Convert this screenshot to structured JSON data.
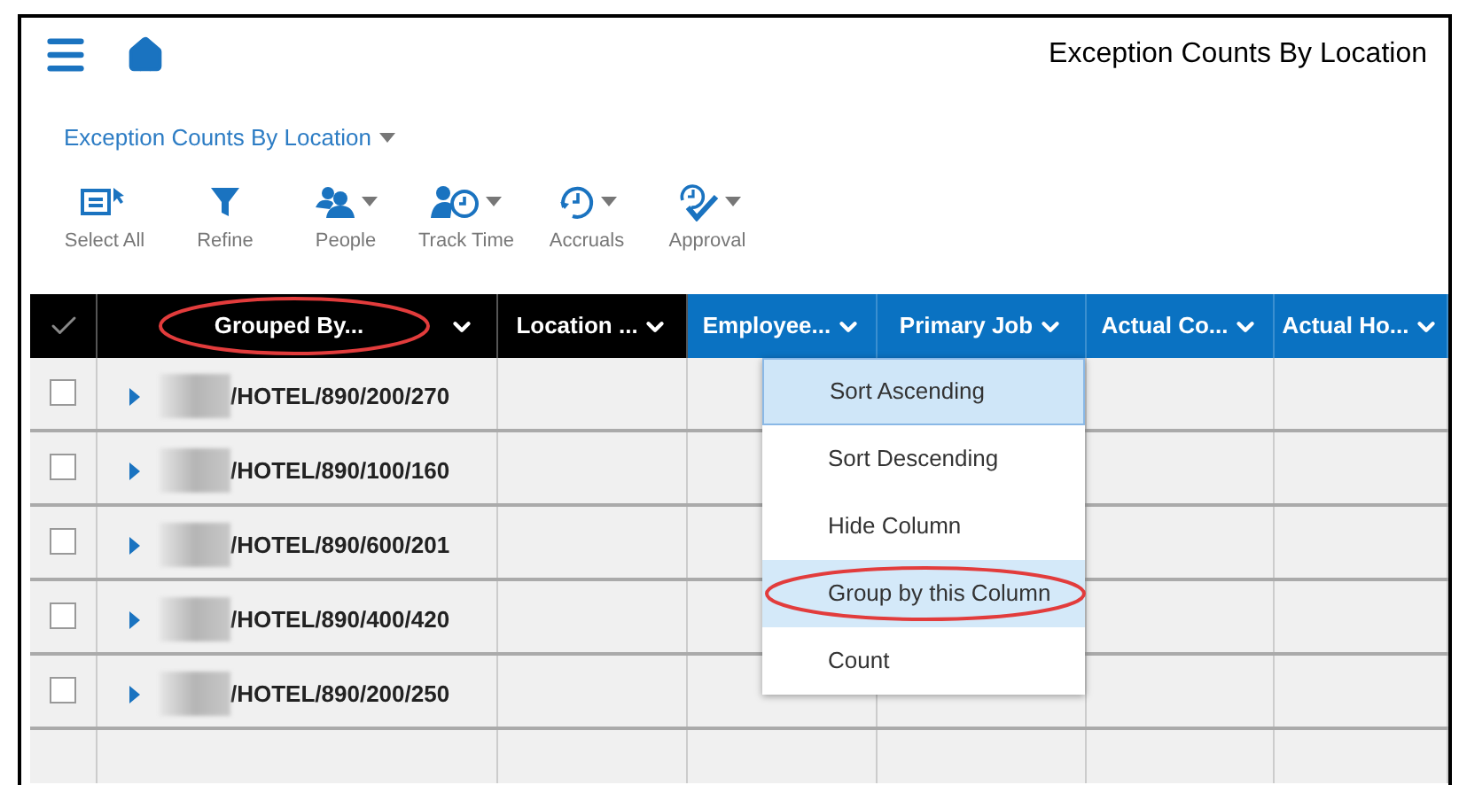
{
  "header": {
    "title": "Exception Counts By Location"
  },
  "view_selector": {
    "label": "Exception Counts By Location"
  },
  "toolbar": [
    {
      "label": "Select All",
      "kind": "select",
      "has_menu": false
    },
    {
      "label": "Refine",
      "kind": "filter",
      "has_menu": false
    },
    {
      "label": "People",
      "kind": "people",
      "has_menu": true
    },
    {
      "label": "Track Time",
      "kind": "time",
      "has_menu": true
    },
    {
      "label": "Accruals",
      "kind": "accruals",
      "has_menu": true
    },
    {
      "label": "Approval",
      "kind": "approval",
      "has_menu": true
    }
  ],
  "table": {
    "select_all_checked": true,
    "columns": [
      {
        "label": "Grouped By...",
        "kind": "group",
        "circled": true
      },
      {
        "label": "Location ...",
        "kind": "group",
        "circled": false
      },
      {
        "label": "Employee...",
        "kind": "data",
        "circled": false
      },
      {
        "label": "Primary Job",
        "kind": "data",
        "circled": false
      },
      {
        "label": "Actual Co...",
        "kind": "data",
        "circled": false
      },
      {
        "label": "Actual Ho...",
        "kind": "data",
        "circled": false
      }
    ],
    "rows": [
      {
        "group": "/HOTEL/890/200/270",
        "checked": false,
        "expanded": false
      },
      {
        "group": "/HOTEL/890/100/160",
        "checked": false,
        "expanded": false
      },
      {
        "group": "/HOTEL/890/600/201",
        "checked": false,
        "expanded": false
      },
      {
        "group": "/HOTEL/890/400/420",
        "checked": false,
        "expanded": false
      },
      {
        "group": "/HOTEL/890/200/250",
        "checked": false,
        "expanded": false
      }
    ]
  },
  "column_menu": {
    "items": [
      {
        "label": "Sort Ascending",
        "selected": true,
        "hovered": false,
        "circled": false
      },
      {
        "label": "Sort Descending",
        "selected": false,
        "hovered": false,
        "circled": false
      },
      {
        "label": "Hide Column",
        "selected": false,
        "hovered": false,
        "circled": false
      },
      {
        "label": "Group by this Column",
        "selected": false,
        "hovered": true,
        "circled": true
      },
      {
        "label": "Count",
        "selected": false,
        "hovered": false,
        "circled": false
      }
    ]
  }
}
